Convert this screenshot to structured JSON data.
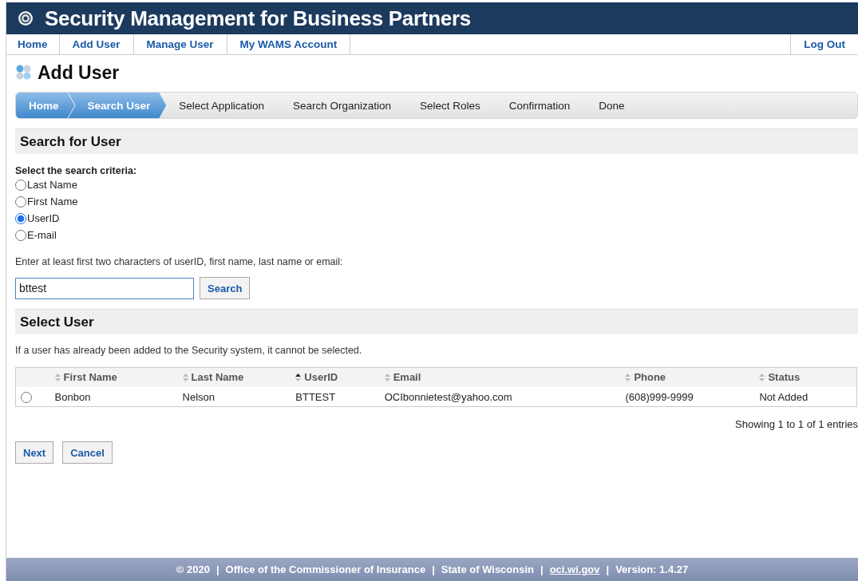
{
  "header": {
    "title": "Security Management for Business Partners"
  },
  "nav": {
    "items": [
      {
        "label": "Home"
      },
      {
        "label": "Add User"
      },
      {
        "label": "Manage User"
      },
      {
        "label": "My WAMS Account"
      }
    ],
    "logout": "Log Out"
  },
  "page_title": "Add User",
  "steps": [
    {
      "label": "Home",
      "active": true
    },
    {
      "label": "Search User",
      "active": true
    },
    {
      "label": "Select Application",
      "active": false
    },
    {
      "label": "Search Organization",
      "active": false
    },
    {
      "label": "Select Roles",
      "active": false
    },
    {
      "label": "Confirmation",
      "active": false
    },
    {
      "label": "Done",
      "active": false
    }
  ],
  "search_section": {
    "heading": "Search for User",
    "criteria_label": "Select the search criteria:",
    "options": [
      {
        "label": "Last Name",
        "selected": false
      },
      {
        "label": "First Name",
        "selected": false
      },
      {
        "label": "UserID",
        "selected": true
      },
      {
        "label": "E-mail",
        "selected": false
      }
    ],
    "hint": "Enter at least first two characters of userID, first name, last name or email:",
    "value": "bttest",
    "button": "Search"
  },
  "select_section": {
    "heading": "Select User",
    "note": "If a user has already been added to the Security system, it cannot be selected.",
    "columns": [
      {
        "label": "First Name",
        "sorted": false
      },
      {
        "label": "Last Name",
        "sorted": false
      },
      {
        "label": "UserID",
        "sorted": true
      },
      {
        "label": "Email",
        "sorted": false
      },
      {
        "label": "Phone",
        "sorted": false
      },
      {
        "label": "Status",
        "sorted": false
      }
    ],
    "rows": [
      {
        "selected": false,
        "cells": [
          "Bonbon",
          "Nelson",
          "BTTEST",
          "OCIbonnietest@yahoo.com",
          "(608)999-9999",
          "Not Added"
        ]
      }
    ],
    "info": "Showing 1 to 1 of 1 entries"
  },
  "buttons": [
    "Next",
    "Cancel"
  ],
  "footer": {
    "separator": "|",
    "items": [
      {
        "text": "© 2020",
        "kind": "text"
      },
      {
        "text": "Office of the Commissioner of Insurance",
        "kind": "text"
      },
      {
        "text": "State of Wisconsin",
        "kind": "text"
      },
      {
        "text": "oci.wi.gov",
        "kind": "link"
      },
      {
        "text": "Version: 1.4.27",
        "kind": "text"
      }
    ]
  }
}
